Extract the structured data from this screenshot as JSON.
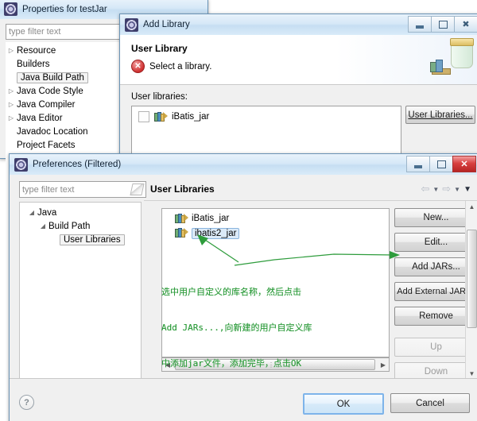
{
  "properties_window": {
    "title": "Properties for testJar",
    "icon": "eclipse-icon",
    "filter": {
      "placeholder": "type filter text",
      "value": ""
    },
    "tree": [
      {
        "label": "Resource",
        "expandable": true,
        "selected": false
      },
      {
        "label": "Builders",
        "expandable": false,
        "selected": false
      },
      {
        "label": "Java Build Path",
        "expandable": false,
        "selected": true
      },
      {
        "label": "Java Code Style",
        "expandable": true,
        "selected": false
      },
      {
        "label": "Java Compiler",
        "expandable": true,
        "selected": false
      },
      {
        "label": "Java Editor",
        "expandable": true,
        "selected": false
      },
      {
        "label": "Javadoc Location",
        "expandable": false,
        "selected": false
      },
      {
        "label": "Project Facets",
        "expandable": false,
        "selected": false
      }
    ]
  },
  "add_library_window": {
    "title": "Add Library",
    "icon": "eclipse-icon",
    "window_buttons": {
      "minimize": "minimize-icon",
      "maximize": "maximize-icon",
      "close": "close-icon"
    },
    "header": {
      "title": "User Library",
      "message": "Select a library.",
      "message_icon": "error-icon",
      "banner_icon": "jar-library-icon"
    },
    "list_label": "User libraries:",
    "libraries": [
      {
        "label": "iBatis_jar",
        "checked": false,
        "icon": "library-icon"
      }
    ],
    "buttons": {
      "user_libraries": "User Libraries..."
    }
  },
  "preferences_window": {
    "title": "Preferences (Filtered)",
    "icon": "eclipse-icon",
    "window_buttons": {
      "minimize": "minimize-icon",
      "maximize": "maximize-icon",
      "close": "close-icon"
    },
    "filter": {
      "placeholder": "type filter text",
      "value": ""
    },
    "tree": [
      {
        "label": "Java",
        "level": 0,
        "expanded": true,
        "selected": false
      },
      {
        "label": "Build Path",
        "level": 1,
        "expanded": true,
        "selected": false
      },
      {
        "label": "User Libraries",
        "level": 2,
        "expanded": false,
        "selected": true
      }
    ],
    "page": {
      "title": "User Libraries",
      "nav_icons": [
        "back-arrow-icon",
        "back-dropdown-icon",
        "forward-arrow-icon",
        "forward-dropdown-icon",
        "menu-dropdown-icon"
      ]
    },
    "libraries": [
      {
        "label": "iBatis_jar",
        "icon": "library-icon",
        "selected": false
      },
      {
        "label": "ibatis2_jar",
        "icon": "library-icon",
        "selected": true
      }
    ],
    "side_buttons": [
      {
        "label": "New...",
        "mnemonic": "N",
        "enabled": true
      },
      {
        "label": "Edit...",
        "mnemonic": "E",
        "enabled": true
      },
      {
        "label": "Add JARs...",
        "mnemonic": "J",
        "enabled": true
      },
      {
        "label": "Add External JARs..",
        "mnemonic": "x",
        "enabled": true
      },
      {
        "label": "Remove",
        "mnemonic": "R",
        "enabled": true
      },
      {
        "label": "Up",
        "mnemonic": "U",
        "enabled": false
      },
      {
        "label": "Down",
        "mnemonic": "o",
        "enabled": false
      }
    ],
    "footer": {
      "help_icon": "help-icon",
      "ok_label": "OK",
      "cancel_label": "Cancel"
    }
  },
  "annotation": {
    "color": "#2e9c3c",
    "lines": [
      "选中用户自定义的库名称，然后点击",
      "Add JARs...,向新建的用户自定义库",
      "中添加jar文件，添加完毕，点击OK"
    ],
    "arrows": [
      "arrow-to-library-item",
      "arrow-to-add-jars-button"
    ]
  }
}
